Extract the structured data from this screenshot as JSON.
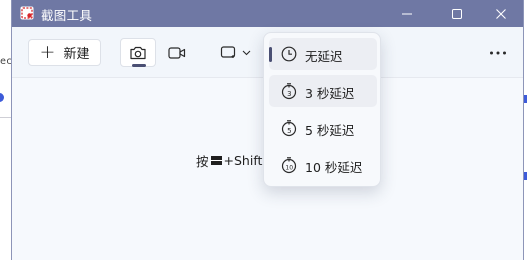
{
  "window": {
    "title": "截图工具",
    "buttons": {
      "minimize": "minimize-icon",
      "maximize": "maximize-icon",
      "close": "close-icon"
    }
  },
  "background": {
    "left_fragment": "ec"
  },
  "toolbar": {
    "new_label": "新建",
    "modes": [
      {
        "name": "screenshot",
        "icon": "camera-icon",
        "active": true
      },
      {
        "name": "record",
        "icon": "video-icon",
        "active": false
      }
    ],
    "shape_icon": "rectangle-mode-icon",
    "more_icon": "more-icon"
  },
  "content": {
    "hint_prefix": "按",
    "hint_suffix": "+Shift"
  },
  "delay_menu": {
    "items": [
      {
        "label": "无延迟",
        "icon": "clock-icon",
        "selected": true
      },
      {
        "label": "3 秒延迟",
        "icon": "timer-3-icon",
        "selected": false
      },
      {
        "label": "5 秒延迟",
        "icon": "timer-5-icon",
        "selected": false
      },
      {
        "label": "10 秒延迟",
        "icon": "timer-10-icon",
        "selected": false
      }
    ]
  },
  "colors": {
    "titlebar": "#6f78a4",
    "accent": "#4a4f73",
    "background_accent": "#3d5bd9"
  }
}
